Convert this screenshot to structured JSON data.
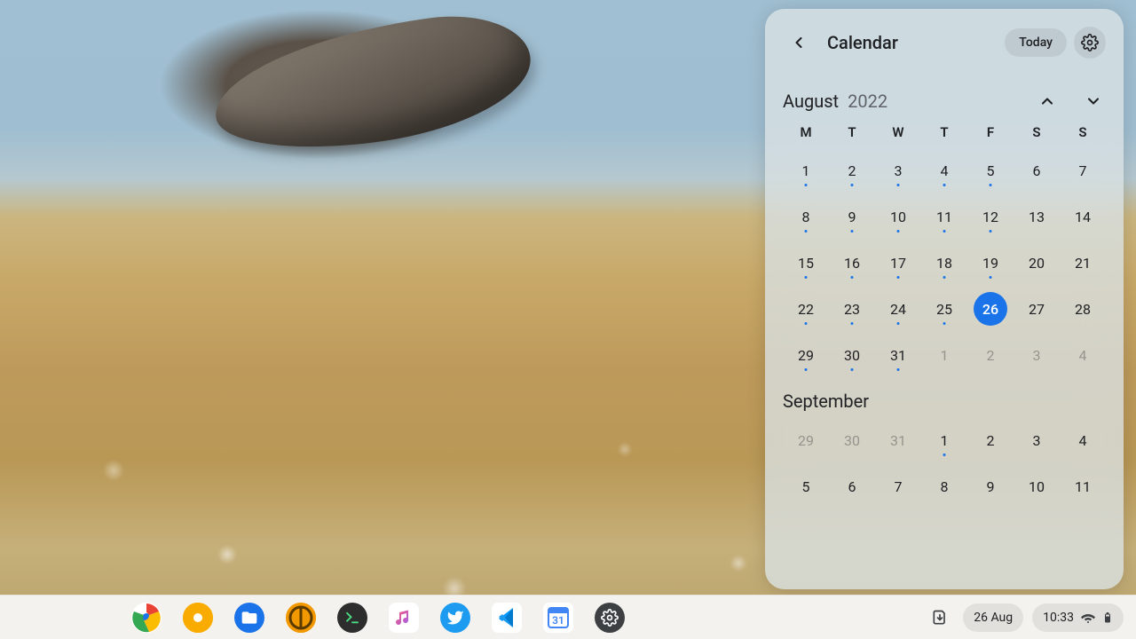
{
  "calendar": {
    "title": "Calendar",
    "today_label": "Today",
    "month_primary": {
      "name": "August",
      "year": "2022"
    },
    "weekday_headers": [
      "M",
      "T",
      "W",
      "T",
      "F",
      "S",
      "S"
    ],
    "weeks_primary": [
      [
        {
          "n": "1",
          "dot": true
        },
        {
          "n": "2",
          "dot": true
        },
        {
          "n": "3",
          "dot": true
        },
        {
          "n": "4",
          "dot": true
        },
        {
          "n": "5",
          "dot": true
        },
        {
          "n": "6"
        },
        {
          "n": "7"
        }
      ],
      [
        {
          "n": "8",
          "dot": true
        },
        {
          "n": "9",
          "dot": true
        },
        {
          "n": "10",
          "dot": true
        },
        {
          "n": "11",
          "dot": true
        },
        {
          "n": "12",
          "dot": true
        },
        {
          "n": "13"
        },
        {
          "n": "14"
        }
      ],
      [
        {
          "n": "15",
          "dot": true
        },
        {
          "n": "16",
          "dot": true
        },
        {
          "n": "17",
          "dot": true
        },
        {
          "n": "18",
          "dot": true
        },
        {
          "n": "19",
          "dot": true
        },
        {
          "n": "20"
        },
        {
          "n": "21"
        }
      ],
      [
        {
          "n": "22",
          "dot": true
        },
        {
          "n": "23",
          "dot": true
        },
        {
          "n": "24",
          "dot": true
        },
        {
          "n": "25",
          "dot": true
        },
        {
          "n": "26",
          "selected": true
        },
        {
          "n": "27"
        },
        {
          "n": "28"
        }
      ],
      [
        {
          "n": "29",
          "dot": true
        },
        {
          "n": "30",
          "dot": true
        },
        {
          "n": "31",
          "dot": true
        },
        {
          "n": "1",
          "other": true
        },
        {
          "n": "2",
          "other": true
        },
        {
          "n": "3",
          "other": true
        },
        {
          "n": "4",
          "other": true
        }
      ]
    ],
    "month_secondary": {
      "name": "September"
    },
    "weeks_secondary": [
      [
        {
          "n": "29",
          "other": true
        },
        {
          "n": "30",
          "other": true
        },
        {
          "n": "31",
          "other": true
        },
        {
          "n": "1",
          "dot": true
        },
        {
          "n": "2"
        },
        {
          "n": "3"
        },
        {
          "n": "4"
        }
      ],
      [
        {
          "n": "5"
        },
        {
          "n": "6"
        },
        {
          "n": "7"
        },
        {
          "n": "8"
        },
        {
          "n": "9"
        },
        {
          "n": "10"
        },
        {
          "n": "11"
        }
      ]
    ]
  },
  "shelf": {
    "apps": [
      {
        "name": "chrome",
        "bg": "#fff"
      },
      {
        "name": "chrome-canary",
        "bg": "linear-gradient(135deg,#f9ab00,#fbbc04)"
      },
      {
        "name": "files",
        "bg": "#1a73e8"
      },
      {
        "name": "calc-app",
        "bg": "#f29900"
      },
      {
        "name": "terminal",
        "bg": "#2d2d2d"
      },
      {
        "name": "music",
        "bg": "#fff"
      },
      {
        "name": "twitter",
        "bg": "#1d9bf0"
      },
      {
        "name": "vscode",
        "bg": "#fff"
      },
      {
        "name": "google-calendar",
        "bg": "#fff"
      },
      {
        "name": "settings",
        "bg": "#3c4043"
      }
    ],
    "tray": {
      "date": "26 Aug",
      "time": "10:33"
    }
  },
  "colors": {
    "accent": "#1a73e8"
  }
}
